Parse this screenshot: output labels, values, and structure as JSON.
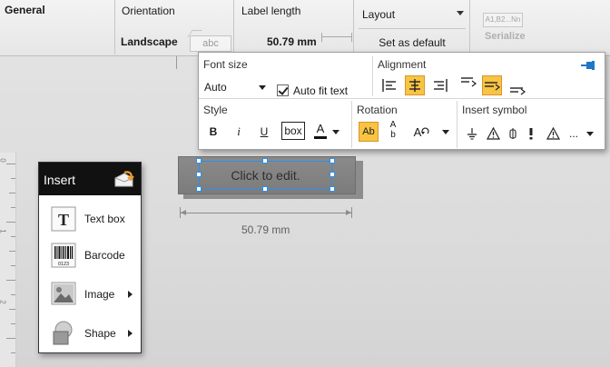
{
  "ribbon": {
    "general_title": "General",
    "orientation": {
      "title": "Orientation",
      "value": "Landscape",
      "preview_text": "abc"
    },
    "label_length": {
      "title": "Label length",
      "value": "50.79 mm"
    },
    "layout": {
      "title": "Layout",
      "set_default": "Set as default"
    },
    "serialize": {
      "icon_text": "A1,B2...Nn",
      "label": "Serialize"
    }
  },
  "properties": {
    "font_size": {
      "title": "Font size",
      "value": "Auto",
      "auto_fit_label": "Auto fit text",
      "auto_fit_checked": true
    },
    "alignment": {
      "title": "Alignment",
      "horizontal_selected": "center",
      "vertical_selected": "middle"
    },
    "style": {
      "title": "Style",
      "bold": "B",
      "italic": "i",
      "underline": "U",
      "box": "box",
      "color_letter": "A"
    },
    "rotation": {
      "title": "Rotation",
      "selected": "horizontal",
      "btn_ab": "Ab",
      "btn_vert_a": "A",
      "btn_vert_b": "b",
      "btn_rot": "A"
    },
    "insert_symbol": {
      "title": "Insert symbol",
      "more": "..."
    }
  },
  "canvas": {
    "textbox_text": "Click to edit.",
    "dimension_label": "50.79 mm",
    "ruler_numbers": [
      "0",
      "1",
      "2"
    ]
  },
  "insert_panel": {
    "title": "Insert",
    "items": [
      {
        "label": "Text box",
        "icon": "text-box-icon",
        "has_submenu": false
      },
      {
        "label": "Barcode",
        "icon": "barcode-icon",
        "has_submenu": false,
        "icon_text": "0123"
      },
      {
        "label": "Image",
        "icon": "image-icon",
        "has_submenu": true
      },
      {
        "label": "Shape",
        "icon": "shape-icon",
        "has_submenu": true
      }
    ]
  },
  "colors": {
    "accent_selected": "#f7c443",
    "selection_handle": "#2f8fe6",
    "label_fill": "#808080",
    "pin": "#1e78c8"
  }
}
